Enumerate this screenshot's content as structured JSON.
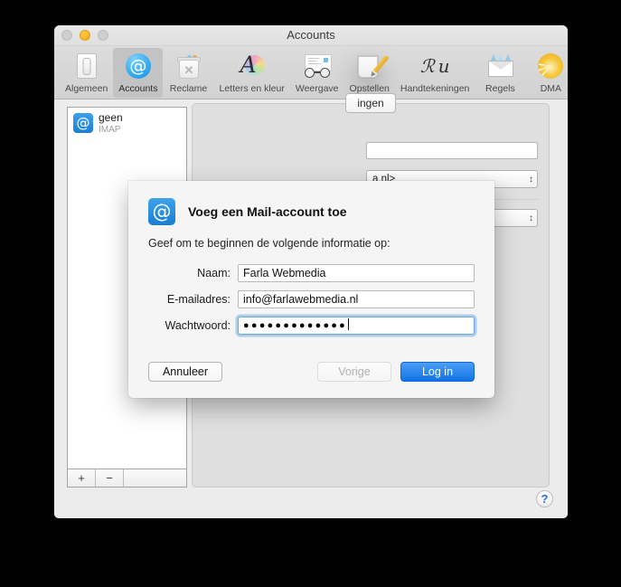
{
  "window": {
    "title": "Accounts",
    "traffic_lights": [
      "close-inactive",
      "minimize-amber",
      "zoom-inactive"
    ]
  },
  "toolbar": {
    "items": [
      {
        "label": "Algemeen",
        "icon": "general-switch-icon",
        "selected": false
      },
      {
        "label": "Accounts",
        "icon": "at-sign-icon",
        "selected": true
      },
      {
        "label": "Reclame",
        "icon": "junk-trash-icon",
        "selected": false
      },
      {
        "label": "Letters en kleur",
        "icon": "font-color-icon",
        "selected": false
      },
      {
        "label": "Weergave",
        "icon": "viewing-glasses-icon",
        "selected": false
      },
      {
        "label": "Opstellen",
        "icon": "compose-pencil-icon",
        "selected": false
      },
      {
        "label": "Handtekeningen",
        "icon": "signature-icon",
        "selected": false
      },
      {
        "label": "Regels",
        "icon": "rules-envelope-icon",
        "selected": false
      },
      {
        "label": "DMA",
        "icon": "dma-sun-icon",
        "selected": false
      }
    ]
  },
  "sidebar": {
    "accounts": [
      {
        "name": "geen",
        "type": "IMAP"
      }
    ],
    "add_label": "+",
    "remove_label": "−"
  },
  "account_panel": {
    "tabs": [
      {
        "label": "ingen",
        "selected": true
      }
    ],
    "fields": [
      {
        "kind": "text",
        "value": ""
      },
      {
        "kind": "popup",
        "value": "a.nl>"
      },
      {
        "kind": "popup",
        "value": ""
      }
    ]
  },
  "help": {
    "label": "?"
  },
  "sheet": {
    "icon": "at-sign-icon",
    "title": "Voeg een Mail-account toe",
    "subtitle": "Geef om te beginnen de volgende informatie op:",
    "fields": [
      {
        "label": "Naam:",
        "value": "Farla Webmedia",
        "focused": false,
        "masked": false
      },
      {
        "label": "E-mailadres:",
        "value": "info@farlawebmedia.nl",
        "focused": false,
        "masked": false
      },
      {
        "label": "Wachtwoord:",
        "value": "●●●●●●●●●●●●●",
        "focused": true,
        "masked": true
      }
    ],
    "buttons": {
      "cancel": "Annuleer",
      "previous": "Vorige",
      "login": "Log in"
    }
  },
  "colors": {
    "accent_blue": "#1273e6",
    "focus_ring": "#70ade4",
    "window_bg": "#ececec",
    "sheet_bg": "#f5f5f5"
  }
}
